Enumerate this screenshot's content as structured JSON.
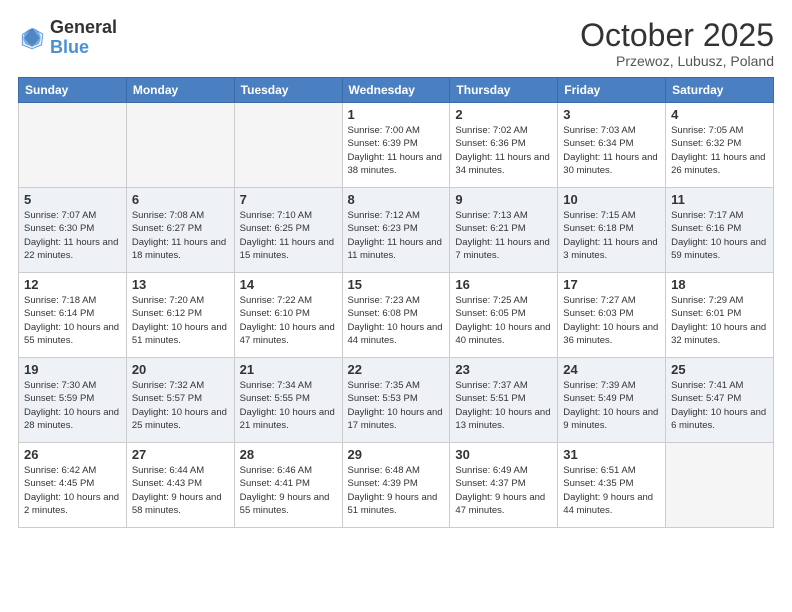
{
  "header": {
    "logo_line1": "General",
    "logo_line2": "Blue",
    "month": "October 2025",
    "location": "Przewoz, Lubusz, Poland"
  },
  "weekdays": [
    "Sunday",
    "Monday",
    "Tuesday",
    "Wednesday",
    "Thursday",
    "Friday",
    "Saturday"
  ],
  "weeks": [
    [
      {
        "day": "",
        "info": ""
      },
      {
        "day": "",
        "info": ""
      },
      {
        "day": "",
        "info": ""
      },
      {
        "day": "1",
        "info": "Sunrise: 7:00 AM\nSunset: 6:39 PM\nDaylight: 11 hours\nand 38 minutes."
      },
      {
        "day": "2",
        "info": "Sunrise: 7:02 AM\nSunset: 6:36 PM\nDaylight: 11 hours\nand 34 minutes."
      },
      {
        "day": "3",
        "info": "Sunrise: 7:03 AM\nSunset: 6:34 PM\nDaylight: 11 hours\nand 30 minutes."
      },
      {
        "day": "4",
        "info": "Sunrise: 7:05 AM\nSunset: 6:32 PM\nDaylight: 11 hours\nand 26 minutes."
      }
    ],
    [
      {
        "day": "5",
        "info": "Sunrise: 7:07 AM\nSunset: 6:30 PM\nDaylight: 11 hours\nand 22 minutes."
      },
      {
        "day": "6",
        "info": "Sunrise: 7:08 AM\nSunset: 6:27 PM\nDaylight: 11 hours\nand 18 minutes."
      },
      {
        "day": "7",
        "info": "Sunrise: 7:10 AM\nSunset: 6:25 PM\nDaylight: 11 hours\nand 15 minutes."
      },
      {
        "day": "8",
        "info": "Sunrise: 7:12 AM\nSunset: 6:23 PM\nDaylight: 11 hours\nand 11 minutes."
      },
      {
        "day": "9",
        "info": "Sunrise: 7:13 AM\nSunset: 6:21 PM\nDaylight: 11 hours\nand 7 minutes."
      },
      {
        "day": "10",
        "info": "Sunrise: 7:15 AM\nSunset: 6:18 PM\nDaylight: 11 hours\nand 3 minutes."
      },
      {
        "day": "11",
        "info": "Sunrise: 7:17 AM\nSunset: 6:16 PM\nDaylight: 10 hours\nand 59 minutes."
      }
    ],
    [
      {
        "day": "12",
        "info": "Sunrise: 7:18 AM\nSunset: 6:14 PM\nDaylight: 10 hours\nand 55 minutes."
      },
      {
        "day": "13",
        "info": "Sunrise: 7:20 AM\nSunset: 6:12 PM\nDaylight: 10 hours\nand 51 minutes."
      },
      {
        "day": "14",
        "info": "Sunrise: 7:22 AM\nSunset: 6:10 PM\nDaylight: 10 hours\nand 47 minutes."
      },
      {
        "day": "15",
        "info": "Sunrise: 7:23 AM\nSunset: 6:08 PM\nDaylight: 10 hours\nand 44 minutes."
      },
      {
        "day": "16",
        "info": "Sunrise: 7:25 AM\nSunset: 6:05 PM\nDaylight: 10 hours\nand 40 minutes."
      },
      {
        "day": "17",
        "info": "Sunrise: 7:27 AM\nSunset: 6:03 PM\nDaylight: 10 hours\nand 36 minutes."
      },
      {
        "day": "18",
        "info": "Sunrise: 7:29 AM\nSunset: 6:01 PM\nDaylight: 10 hours\nand 32 minutes."
      }
    ],
    [
      {
        "day": "19",
        "info": "Sunrise: 7:30 AM\nSunset: 5:59 PM\nDaylight: 10 hours\nand 28 minutes."
      },
      {
        "day": "20",
        "info": "Sunrise: 7:32 AM\nSunset: 5:57 PM\nDaylight: 10 hours\nand 25 minutes."
      },
      {
        "day": "21",
        "info": "Sunrise: 7:34 AM\nSunset: 5:55 PM\nDaylight: 10 hours\nand 21 minutes."
      },
      {
        "day": "22",
        "info": "Sunrise: 7:35 AM\nSunset: 5:53 PM\nDaylight: 10 hours\nand 17 minutes."
      },
      {
        "day": "23",
        "info": "Sunrise: 7:37 AM\nSunset: 5:51 PM\nDaylight: 10 hours\nand 13 minutes."
      },
      {
        "day": "24",
        "info": "Sunrise: 7:39 AM\nSunset: 5:49 PM\nDaylight: 10 hours\nand 9 minutes."
      },
      {
        "day": "25",
        "info": "Sunrise: 7:41 AM\nSunset: 5:47 PM\nDaylight: 10 hours\nand 6 minutes."
      }
    ],
    [
      {
        "day": "26",
        "info": "Sunrise: 6:42 AM\nSunset: 4:45 PM\nDaylight: 10 hours\nand 2 minutes."
      },
      {
        "day": "27",
        "info": "Sunrise: 6:44 AM\nSunset: 4:43 PM\nDaylight: 9 hours\nand 58 minutes."
      },
      {
        "day": "28",
        "info": "Sunrise: 6:46 AM\nSunset: 4:41 PM\nDaylight: 9 hours\nand 55 minutes."
      },
      {
        "day": "29",
        "info": "Sunrise: 6:48 AM\nSunset: 4:39 PM\nDaylight: 9 hours\nand 51 minutes."
      },
      {
        "day": "30",
        "info": "Sunrise: 6:49 AM\nSunset: 4:37 PM\nDaylight: 9 hours\nand 47 minutes."
      },
      {
        "day": "31",
        "info": "Sunrise: 6:51 AM\nSunset: 4:35 PM\nDaylight: 9 hours\nand 44 minutes."
      },
      {
        "day": "",
        "info": ""
      }
    ]
  ]
}
